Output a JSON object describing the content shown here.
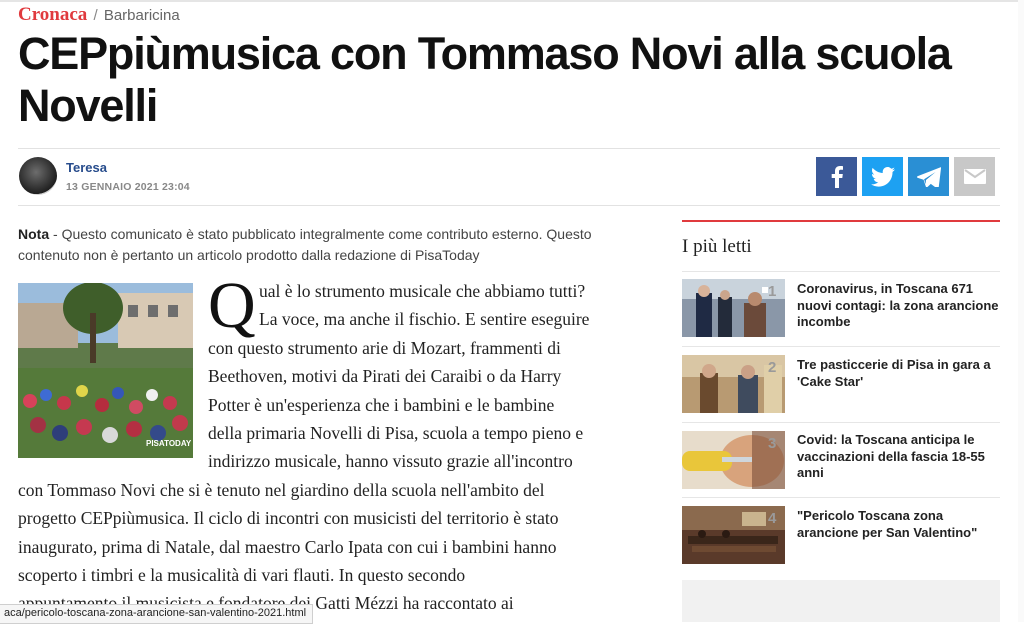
{
  "breadcrumb": {
    "section": "Cronaca",
    "separator": "/",
    "subsection": "Barbaricina"
  },
  "article": {
    "title": "CEPpiùmusica con Tommaso Novi alla scuola Novelli",
    "author": "Teresa",
    "date": "13 GENNAIO 2021 23:04",
    "note_label": "Nota",
    "note_text": " - Questo comunicato è stato pubblicato integralmente come contributo esterno. Questo contenuto non è pertanto un articolo prodotto dalla redazione di PisaToday",
    "photo_watermark": "PISATODAY",
    "drop_cap": "Q",
    "body_lines": [
      "ual è lo strumento musicale che abbiamo tutti?",
      "La voce, ma anche il fischio. E sentire eseguire",
      "con questo strumento arie di Mozart, frammenti di",
      "Beethoven, motivi da Pirati dei Caraibi o da Harry",
      "Potter è un'esperienza che i bambini e le bambine",
      "della primaria Novelli di Pisa, scuola a tempo pieno e",
      "indirizzo musicale, hanno vissuto grazie all'incontro",
      "con Tommaso Novi che si è tenuto nel giardino della scuola nell'ambito del",
      "progetto CEPpiùmusica. Il ciclo di incontri con musicisti del territorio è stato",
      "inaugurato, prima di Natale, dal maestro Carlo Ipata con cui i bambini hanno",
      "scoperto i timbri e la musicalità di vari flauti. In questo secondo",
      "appuntamento il musicista e fondatore dei Gatti Mézzi ha raccontato ai"
    ]
  },
  "share": {
    "facebook_color": "#3b5998",
    "twitter_color": "#1da1f2",
    "telegram_color": "#2a8fd4",
    "email_color": "#c8c8c8",
    "icons": [
      "facebook-icon",
      "twitter-icon",
      "telegram-icon",
      "email-icon"
    ]
  },
  "sidebar": {
    "title": "I più letti",
    "items": [
      {
        "rank": "1",
        "title": "Coronavirus, in Toscana 671 nuovi contagi: la zona arancione incombe"
      },
      {
        "rank": "2",
        "title": "Tre pasticcerie di Pisa in gara a 'Cake Star'"
      },
      {
        "rank": "3",
        "title": "Covid: la Toscana anticipa le vaccinazioni della fascia 18-55 anni"
      },
      {
        "rank": "4",
        "title": "\"Pericolo Toscana zona arancione per San Valentino\""
      }
    ]
  },
  "status_bar": {
    "url": "aca/pericolo-toscana-zona-arancione-san-valentino-2021.html"
  },
  "colors": {
    "accent": "#e03a3e",
    "author": "#274c8c"
  }
}
